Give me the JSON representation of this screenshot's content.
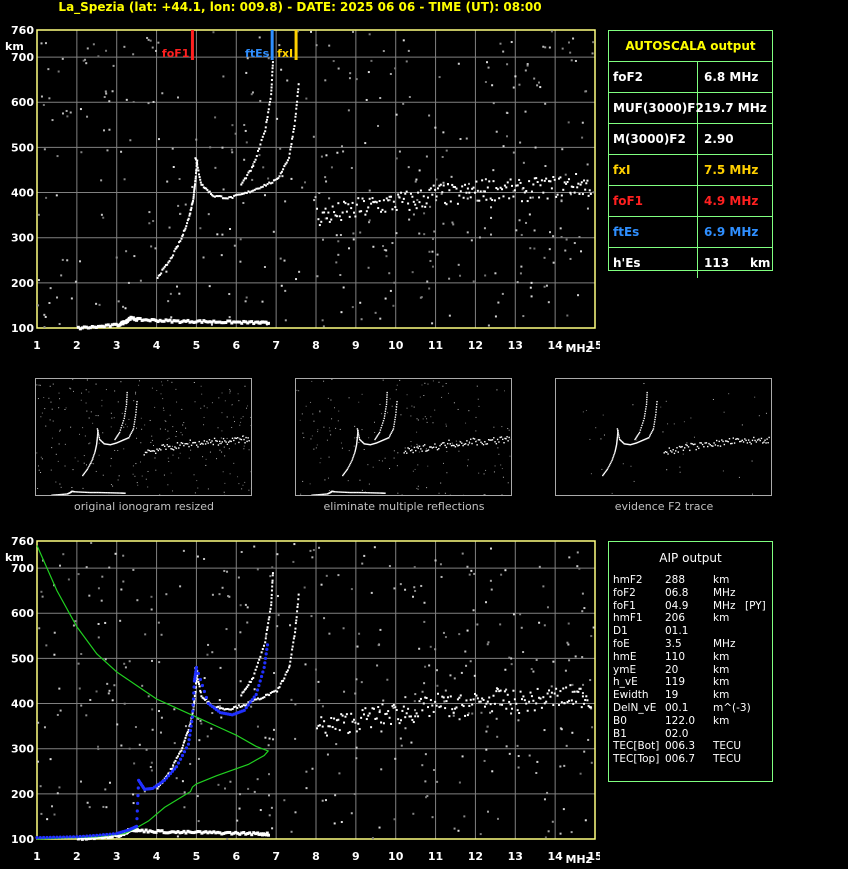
{
  "header": {
    "title": "La_Spezia (lat: +44.1, lon: 009.8) - DATE: 2025 06 06 - TIME (UT): 08:00"
  },
  "colors": {
    "grid": "#808080",
    "frame": "#ffff80",
    "foF1": "#ff2020",
    "ftEs": "#2f8fff",
    "fxI": "#ffd000",
    "profile": "#20d020",
    "aip_trace": "#2030ff",
    "table_border": "#80ff80"
  },
  "chart_data": [
    {
      "type": "scatter",
      "title": "",
      "xlabel": "MHz",
      "ylabel": "km",
      "xlim": [
        1,
        15
      ],
      "ylim": [
        100,
        760
      ],
      "xticks": [
        1,
        2,
        3,
        4,
        5,
        6,
        7,
        8,
        9,
        10,
        11,
        12,
        13,
        14,
        15
      ],
      "yticks": [
        100,
        200,
        300,
        400,
        500,
        600,
        700,
        760
      ],
      "markers": [
        {
          "name": "foF1",
          "x": 4.9
        },
        {
          "name": "ftEs",
          "x": 6.9
        },
        {
          "name": "fxI",
          "x": 7.5
        }
      ],
      "marker_labels": {
        "foF1": "foF1",
        "ftEs": "ftEs",
        "fxI": "fxI"
      },
      "traces": [
        {
          "name": "E-layer",
          "points": [
            [
              2.0,
              103
            ],
            [
              2.5,
              106
            ],
            [
              3.0,
              110
            ],
            [
              3.2,
              118
            ],
            [
              3.3,
              125
            ],
            [
              3.5,
              122
            ],
            [
              4.0,
              120
            ],
            [
              4.5,
              118
            ],
            [
              5.0,
              118
            ],
            [
              5.5,
              117
            ],
            [
              6.0,
              116
            ],
            [
              6.5,
              115
            ],
            [
              6.8,
              114
            ]
          ]
        },
        {
          "name": "F1-layer",
          "points": [
            [
              4.0,
              215
            ],
            [
              4.3,
              250
            ],
            [
              4.6,
              300
            ],
            [
              4.8,
              350
            ],
            [
              4.9,
              390
            ],
            [
              4.95,
              430
            ],
            [
              5.0,
              480
            ]
          ]
        },
        {
          "name": "F2-layer",
          "points": [
            [
              4.95,
              480
            ],
            [
              5.1,
              420
            ],
            [
              5.4,
              395
            ],
            [
              5.8,
              390
            ],
            [
              6.2,
              400
            ],
            [
              6.6,
              415
            ],
            [
              7.0,
              430
            ],
            [
              7.3,
              480
            ],
            [
              7.45,
              560
            ],
            [
              7.55,
              650
            ]
          ]
        },
        {
          "name": "F2-o",
          "points": [
            [
              6.1,
              420
            ],
            [
              6.4,
              460
            ],
            [
              6.7,
              540
            ],
            [
              6.85,
              620
            ],
            [
              6.9,
              700
            ]
          ]
        },
        {
          "name": "Es-spread",
          "points": [
            [
              8.0,
              350
            ],
            [
              8.5,
              355
            ],
            [
              9.0,
              365
            ],
            [
              9.5,
              375
            ],
            [
              10.0,
              380
            ],
            [
              10.5,
              385
            ],
            [
              11.0,
              400
            ],
            [
              11.5,
              395
            ],
            [
              12.0,
              405
            ],
            [
              12.5,
              410
            ],
            [
              13.0,
              405
            ],
            [
              13.5,
              410
            ],
            [
              14.0,
              415
            ],
            [
              14.5,
              420
            ],
            [
              14.9,
              415
            ]
          ]
        }
      ]
    },
    {
      "type": "scatter",
      "title": "",
      "xlabel": "MHz",
      "ylabel": "km",
      "xlim": [
        1,
        15
      ],
      "ylim": [
        100,
        760
      ],
      "xticks": [
        1,
        2,
        3,
        4,
        5,
        6,
        7,
        8,
        9,
        10,
        11,
        12,
        13,
        14,
        15
      ],
      "yticks": [
        100,
        200,
        300,
        400,
        500,
        600,
        700,
        760
      ],
      "profile": [
        [
          1.0,
          750
        ],
        [
          1.5,
          650
        ],
        [
          2.0,
          570
        ],
        [
          2.5,
          510
        ],
        [
          3.0,
          470
        ],
        [
          3.5,
          440
        ],
        [
          4.0,
          410
        ],
        [
          4.5,
          390
        ],
        [
          5.0,
          370
        ],
        [
          5.5,
          350
        ],
        [
          6.0,
          330
        ],
        [
          6.5,
          305
        ],
        [
          6.8,
          295
        ],
        [
          6.7,
          285
        ],
        [
          6.3,
          265
        ],
        [
          5.5,
          240
        ],
        [
          5.0,
          222
        ],
        [
          4.9,
          215
        ],
        [
          4.85,
          205
        ],
        [
          4.2,
          170
        ],
        [
          3.8,
          140
        ],
        [
          3.5,
          125
        ],
        [
          3.2,
          112
        ],
        [
          2.5,
          105
        ],
        [
          1.0,
          100
        ]
      ],
      "aip_trace": [
        [
          1.0,
          103
        ],
        [
          1.5,
          104
        ],
        [
          2.0,
          105
        ],
        [
          2.5,
          108
        ],
        [
          3.0,
          112
        ],
        [
          3.3,
          120
        ],
        [
          3.5,
          128
        ],
        [
          3.55,
          230
        ],
        [
          3.7,
          210
        ],
        [
          3.9,
          212
        ],
        [
          4.2,
          230
        ],
        [
          4.5,
          260
        ],
        [
          4.8,
          310
        ],
        [
          4.9,
          370
        ],
        [
          4.95,
          450
        ],
        [
          5.0,
          480
        ],
        [
          5.3,
          400
        ],
        [
          5.6,
          380
        ],
        [
          5.9,
          375
        ],
        [
          6.2,
          385
        ],
        [
          6.5,
          420
        ],
        [
          6.7,
          480
        ],
        [
          6.8,
          540
        ]
      ]
    }
  ],
  "thumbnails": [
    {
      "caption": "original ionogram resized"
    },
    {
      "caption": "eliminate multiple reflections"
    },
    {
      "caption": "evidence F2 trace"
    }
  ],
  "autoscala": {
    "header": "AUTOSCALA output",
    "rows": [
      {
        "key": "foF2",
        "value": "6.8 MHz",
        "color": "#ffffff"
      },
      {
        "key": "MUF(3000)F2",
        "value": "19.7 MHz",
        "color": "#ffffff"
      },
      {
        "key": "M(3000)F2",
        "value": "2.90",
        "color": "#ffffff"
      },
      {
        "key": "fxI",
        "value": "7.5 MHz",
        "color": "#ffd000"
      },
      {
        "key": "foF1",
        "value": "4.9 MHz",
        "color": "#ff2020"
      },
      {
        "key": "ftEs",
        "value": "6.9 MHz",
        "color": "#2f8fff"
      },
      {
        "key": "h'Es",
        "value": "113     km",
        "color": "#ffffff"
      }
    ]
  },
  "aip": {
    "header": "AIP output",
    "rows": [
      {
        "name": "hmF2",
        "value": "288",
        "unit": "km",
        "extra": ""
      },
      {
        "name": "foF2",
        "value": "06.8",
        "unit": "MHz",
        "extra": ""
      },
      {
        "name": "foF1",
        "value": "04.9",
        "unit": "MHz",
        "extra": "[PY]"
      },
      {
        "name": "hmF1",
        "value": "206",
        "unit": "km",
        "extra": ""
      },
      {
        "name": "D1",
        "value": "01.1",
        "unit": "",
        "extra": ""
      },
      {
        "name": "foE",
        "value": "3.5",
        "unit": "MHz",
        "extra": ""
      },
      {
        "name": "hmE",
        "value": "110",
        "unit": "km",
        "extra": ""
      },
      {
        "name": "ymE",
        "value": "20",
        "unit": "km",
        "extra": ""
      },
      {
        "name": "h_vE",
        "value": "119",
        "unit": "km",
        "extra": ""
      },
      {
        "name": "Ewidth",
        "value": "19",
        "unit": "km",
        "extra": ""
      },
      {
        "name": "DelN_vE",
        "value": "00.1",
        "unit": "m^(-3)",
        "extra": ""
      },
      {
        "name": "B0",
        "value": "122.0",
        "unit": "km",
        "extra": ""
      },
      {
        "name": "B1",
        "value": "02.0",
        "unit": "",
        "extra": ""
      },
      {
        "name": "TEC[Bot]",
        "value": "006.3",
        "unit": "TECU",
        "extra": ""
      },
      {
        "name": "TEC[Top]",
        "value": "006.7",
        "unit": "TECU",
        "extra": ""
      }
    ]
  }
}
